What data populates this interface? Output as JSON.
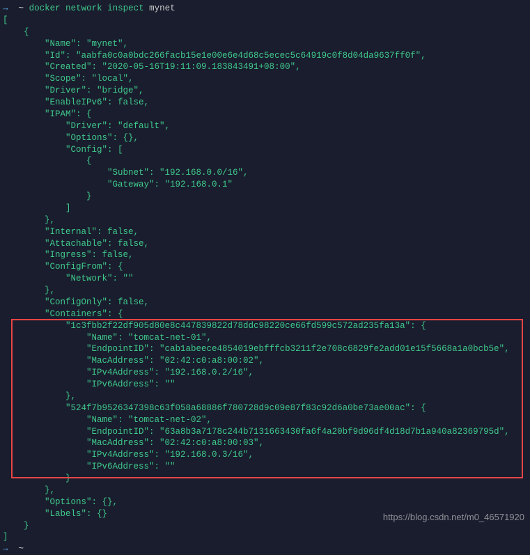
{
  "prompt": {
    "arrow": "→",
    "tilde": "~",
    "command": "docker network inspect",
    "arg": "mynet"
  },
  "out": {
    "open_bracket": "[",
    "open_brace": "    {",
    "name_line": "        \"Name\": \"mynet\",",
    "id_line": "        \"Id\": \"aabfa0c0a0bdc266facb15e1e00e6e4d68c5ecec5c64919c0f8d04da9637ff0f\",",
    "created_line": "        \"Created\": \"2020-05-16T19:11:09.183843491+08:00\",",
    "scope_line": "        \"Scope\": \"local\",",
    "driver_line": "        \"Driver\": \"bridge\",",
    "enableipv6_line": "        \"EnableIPv6\": false,",
    "ipam_open": "        \"IPAM\": {",
    "ipam_driver": "            \"Driver\": \"default\",",
    "ipam_options": "            \"Options\": {},",
    "ipam_config_open": "            \"Config\": [",
    "ipam_config_brace": "                {",
    "ipam_subnet": "                    \"Subnet\": \"192.168.0.0/16\",",
    "ipam_gateway": "                    \"Gateway\": \"192.168.0.1\"",
    "ipam_config_close_brace": "                }",
    "ipam_config_close": "            ]",
    "ipam_close": "        },",
    "internal_line": "        \"Internal\": false,",
    "attachable_line": "        \"Attachable\": false,",
    "ingress_line": "        \"Ingress\": false,",
    "configfrom_open": "        \"ConfigFrom\": {",
    "configfrom_network": "            \"Network\": \"\"",
    "configfrom_close": "        },",
    "configonly_line": "        \"ConfigOnly\": false,",
    "containers_open": "        \"Containers\": {",
    "c1_id": "            \"1c3fbb2f22df905d80e8c447839822d78ddc98220ce66fd599c572ad235fa13a\": {",
    "c1_name": "                \"Name\": \"tomcat-net-01\",",
    "c1_endpoint": "                \"EndpointID\": \"cab1abeece4854019ebfffcb3211f2e708c6829fe2add01e15f5668a1a0bcb5e\",",
    "c1_mac": "                \"MacAddress\": \"02:42:c0:a8:00:02\",",
    "c1_ipv4": "                \"IPv4Address\": \"192.168.0.2/16\",",
    "c1_ipv6": "                \"IPv6Address\": \"\"",
    "c1_close": "            },",
    "c2_id": "            \"524f7b9526347398c63f058a68886f780728d9c09e87f83c92d6a0be73ae00ac\": {",
    "c2_name": "                \"Name\": \"tomcat-net-02\",",
    "c2_endpoint": "                \"EndpointID\": \"63a8b3a7178c244b7131663430fa6f4a20bf9d96df4d18d7b1a940a82369795d\",",
    "c2_mac": "                \"MacAddress\": \"02:42:c0:a8:00:03\",",
    "c2_ipv4": "                \"IPv4Address\": \"192.168.0.3/16\",",
    "c2_ipv6": "                \"IPv6Address\": \"\"",
    "c2_close": "            }",
    "containers_close": "        },",
    "options_line": "        \"Options\": {},",
    "labels_line": "        \"Labels\": {}",
    "close_brace": "    }",
    "close_bracket": "]"
  },
  "watermark": "https://blog.csdn.net/m0_46571920"
}
